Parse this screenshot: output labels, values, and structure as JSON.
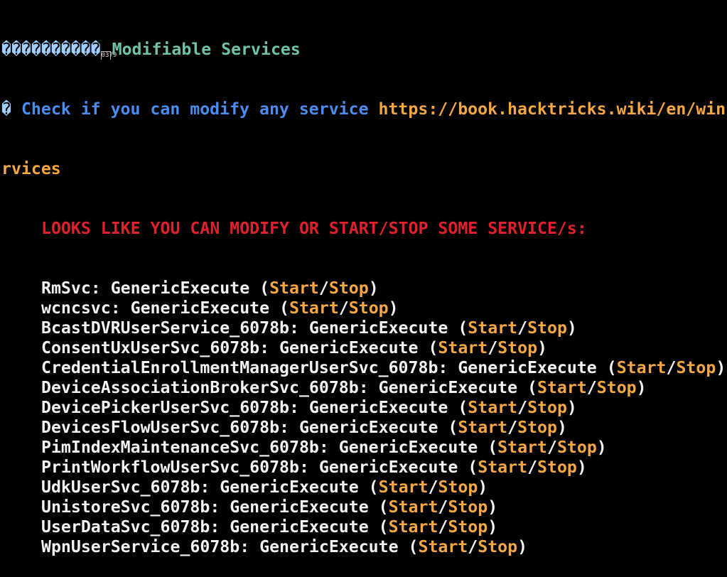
{
  "header": {
    "prefix_glyphs": "����������",
    "box_glyph": "0379",
    "title": "Modifiable Services"
  },
  "check": {
    "bullet": "�",
    "text": "Check if you can modify any service",
    "url_part1": "https://book.hacktricks.wiki/en/win",
    "url_part2": "rvices"
  },
  "warning": "LOOKS LIKE YOU CAN MODIFY OR START/STOP SOME SERVICE/s:",
  "services": [
    {
      "name": "RmSvc: GenericExecute (",
      "start": "Start",
      "sep": "/",
      "stop": "Stop",
      "close": ")"
    },
    {
      "name": "wcncsvc: GenericExecute (",
      "start": "Start",
      "sep": "/",
      "stop": "Stop",
      "close": ")"
    },
    {
      "name": "BcastDVRUserService_6078b: GenericExecute (",
      "start": "Start",
      "sep": "/",
      "stop": "Stop",
      "close": ")"
    },
    {
      "name": "ConsentUxUserSvc_6078b: GenericExecute (",
      "start": "Start",
      "sep": "/",
      "stop": "Stop",
      "close": ")"
    },
    {
      "name": "CredentialEnrollmentManagerUserSvc_6078b: GenericExecute (",
      "start": "Start",
      "sep": "/",
      "stop": "Stop",
      "close": ")"
    },
    {
      "name": "DeviceAssociationBrokerSvc_6078b: GenericExecute (",
      "start": "Start",
      "sep": "/",
      "stop": "Stop",
      "close": ")"
    },
    {
      "name": "DevicePickerUserSvc_6078b: GenericExecute (",
      "start": "Start",
      "sep": "/",
      "stop": "Stop",
      "close": ")"
    },
    {
      "name": "DevicesFlowUserSvc_6078b: GenericExecute (",
      "start": "Start",
      "sep": "/",
      "stop": "Stop",
      "close": ")"
    },
    {
      "name": "PimIndexMaintenanceSvc_6078b: GenericExecute (",
      "start": "Start",
      "sep": "/",
      "stop": "Stop",
      "close": ")"
    },
    {
      "name": "PrintWorkflowUserSvc_6078b: GenericExecute (",
      "start": "Start",
      "sep": "/",
      "stop": "Stop",
      "close": ")"
    },
    {
      "name": "UdkUserSvc_6078b: GenericExecute (",
      "start": "Start",
      "sep": "/",
      "stop": "Stop",
      "close": ")"
    },
    {
      "name": "UnistoreSvc_6078b: GenericExecute (",
      "start": "Start",
      "sep": "/",
      "stop": "Stop",
      "close": ")"
    },
    {
      "name": "UserDataSvc_6078b: GenericExecute (",
      "start": "Start",
      "sep": "/",
      "stop": "Stop",
      "close": ")"
    },
    {
      "name": "WpnUserService_6078b: GenericExecute (",
      "start": "Start",
      "sep": "/",
      "stop": "Stop",
      "close": ")"
    }
  ],
  "colors": {
    "background": "#000000",
    "title": "#6fc2a6",
    "check_text": "#4a8cf0",
    "url": "#f5a742",
    "warning": "#e0202a",
    "service_text": "#f2f2f2",
    "start_stop": "#f5a742"
  }
}
